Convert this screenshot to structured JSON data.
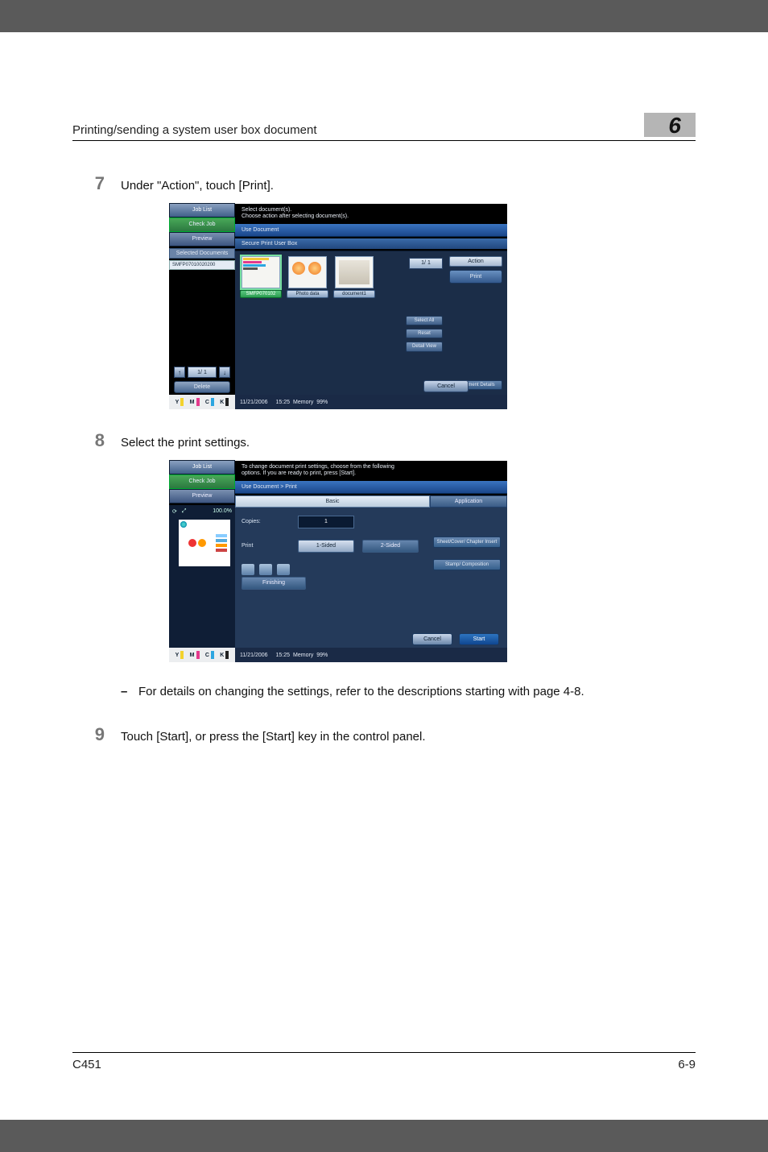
{
  "header": {
    "title": "Printing/sending a system user box document",
    "chapter": "6"
  },
  "steps": {
    "s7": {
      "num": "7",
      "text": "Under \"Action\", touch [Print]."
    },
    "s8": {
      "num": "8",
      "text": "Select the print settings."
    },
    "s9": {
      "num": "9",
      "text": "Touch [Start], or press the [Start] key in the control panel."
    }
  },
  "bullet": {
    "dash": "–",
    "text": "For details on changing the settings, refer to the descriptions starting with page 4-8."
  },
  "footer": {
    "left": "C451",
    "right": "6-9"
  },
  "mfp1": {
    "msg1": "Select document(s).",
    "msg2": "Choose action after selecting document(s).",
    "job_list": "Job List",
    "check_job": "Check Job",
    "preview": "Preview",
    "selected_hdr": "Selected Documents",
    "selected_item": "SMFP07010020200",
    "bar1": "Use Document",
    "bar2": "Secure Print User Box",
    "thumbs": [
      {
        "label": "SMFP070102",
        "selected": true
      },
      {
        "label": "Photo data",
        "selected": false
      },
      {
        "label": "document1",
        "selected": false
      }
    ],
    "pager_top": "1/  1",
    "action": "Action",
    "print": "Print",
    "select_all": "Select All",
    "reset": "Reset",
    "detail_view": "Detail View",
    "doc_details": "Document Details",
    "pager_left": "1/  1",
    "delete_btn": "Delete",
    "cancel": "Cancel",
    "date": "11/21/2006",
    "time": "15:25",
    "memory": "Memory",
    "mem_pct": "99%",
    "toner": {
      "y": "Y",
      "m": "M",
      "c": "C",
      "k": "K"
    }
  },
  "mfp2": {
    "msg1": "To change document print settings, choose from the following",
    "msg2": "options. If you are ready to print, press [Start].",
    "job_list": "Job List",
    "check_job": "Check Job",
    "preview": "Preview",
    "preview_zoom_icon": "⤢",
    "preview_zoom": "100.0%",
    "bar1": "Use Document > Print",
    "tab_basic": "Basic",
    "tab_app": "Application",
    "copies_label": "Copies:",
    "copies_value": "1",
    "print_label": "Print",
    "one_sided": "1-Sided",
    "two_sided": "2-Sided",
    "sheet_cover": "Sheet/Cover/ Chapter Insert",
    "stamp": "Stamp/ Composition",
    "finishing": "Finishing",
    "cancel": "Cancel",
    "start": "Start",
    "date": "11/21/2006",
    "time": "15:25",
    "memory": "Memory",
    "mem_pct": "99%",
    "toner": {
      "y": "Y",
      "m": "M",
      "c": "C",
      "k": "K"
    }
  }
}
